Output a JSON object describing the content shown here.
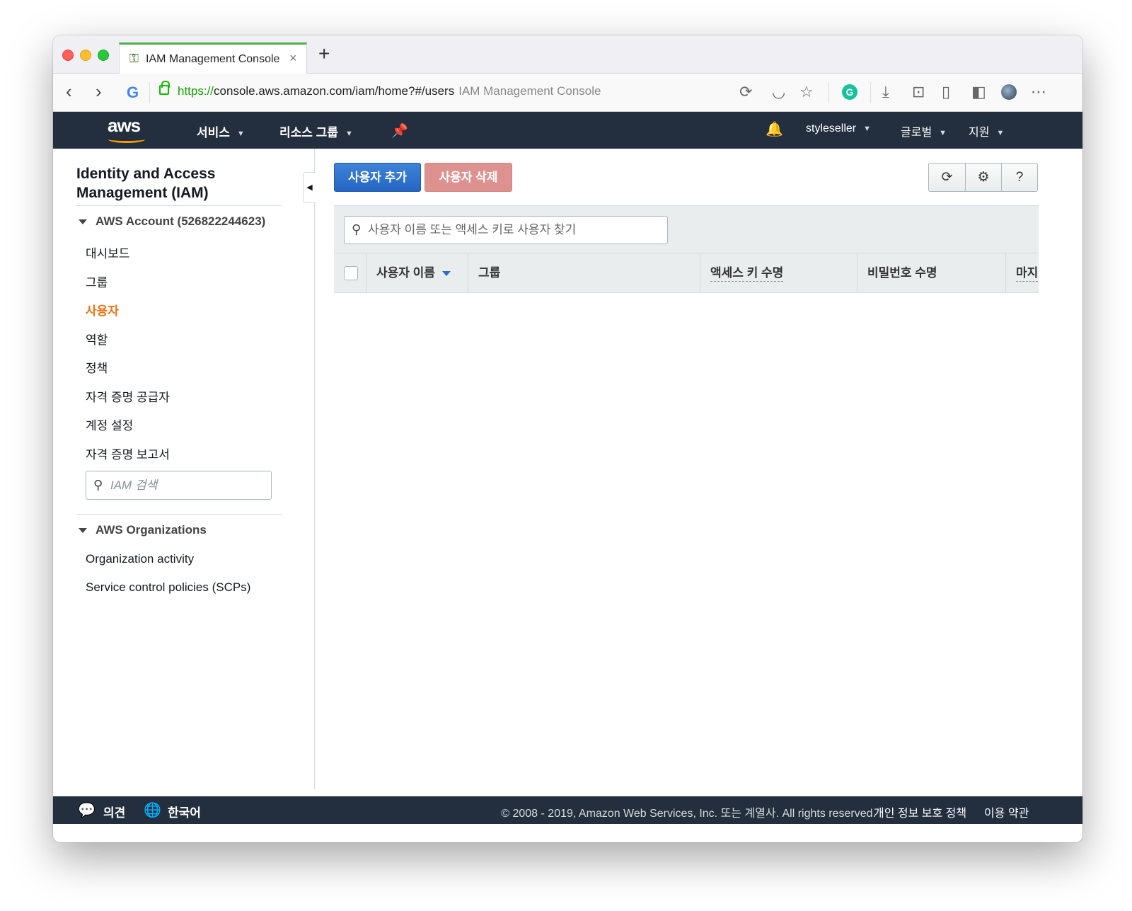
{
  "browser": {
    "tab": {
      "title": "IAM Management Console",
      "icon": "aws-key-icon"
    },
    "url": {
      "scheme": "https://",
      "rest": "console.aws.amazon.com/iam/home?#/users",
      "page_title": "IAM Management Console"
    }
  },
  "aws_nav": {
    "logo": "aws",
    "services": "서비스",
    "resource_groups": "리소스 그룹",
    "account": "styleseller",
    "region": "글로벌",
    "support": "지원"
  },
  "sidebar": {
    "title": "Identity and Access Management (IAM)",
    "account_section": "AWS Account (526822244623)",
    "items": [
      {
        "label": "대시보드",
        "active": false
      },
      {
        "label": "그룹",
        "active": false
      },
      {
        "label": "사용자",
        "active": true
      },
      {
        "label": "역할",
        "active": false
      },
      {
        "label": "정책",
        "active": false
      },
      {
        "label": "자격 증명 공급자",
        "active": false
      },
      {
        "label": "계정 설정",
        "active": false
      },
      {
        "label": "자격 증명 보고서",
        "active": false
      }
    ],
    "search_placeholder": "IAM 검색",
    "org_section": "AWS Organizations",
    "org_items": [
      {
        "label": "Organization activity"
      },
      {
        "label": "Service control policies (SCPs)"
      }
    ]
  },
  "main": {
    "add_user": "사용자 추가",
    "delete_user": "사용자 삭제",
    "search_placeholder": "사용자 이름 또는 액세스 키로 사용자 찾기",
    "columns": [
      "사용자 이름",
      "그룹",
      "액세스 키 수명",
      "비밀번호 수명",
      "마지"
    ]
  },
  "footer": {
    "feedback": "의견",
    "language": "한국어",
    "copyright": "© 2008 - 2019, Amazon Web Services, Inc. 또는 계열사. All rights reserved.",
    "privacy": "개인 정보 보호 정책",
    "terms": "이용 약관"
  },
  "colors": {
    "nav_bg": "#232f3e",
    "active_item": "#ec7211",
    "primary_button": "#2466c2",
    "danger_button": "#de9290",
    "aws_smile": "#ff9900"
  }
}
